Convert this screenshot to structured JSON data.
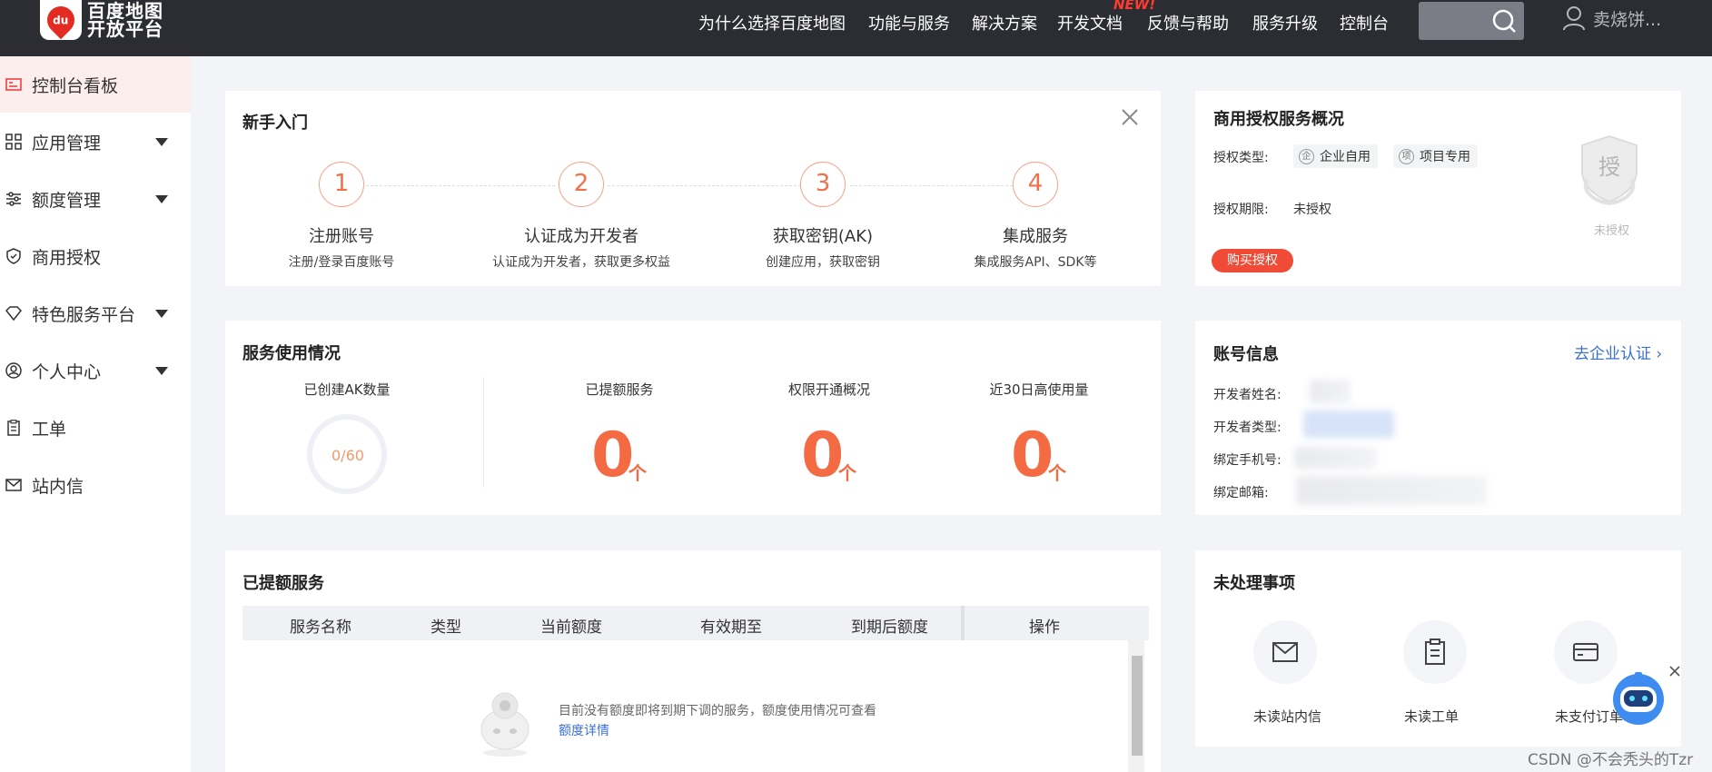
{
  "brand": {
    "logo_mark": "du",
    "name_line1": "百度地图",
    "name_line2": "开放平台"
  },
  "nav": {
    "items": [
      "为什么选择百度地图",
      "功能与服务",
      "解决方案",
      "开发文档",
      "反馈与帮助",
      "服务升级",
      "控制台"
    ],
    "new_badge": "NEW!",
    "user_name": "卖烧饼..."
  },
  "sidebar": {
    "items": [
      {
        "label": "控制台看板",
        "icon": "dashboard-icon",
        "expandable": false,
        "active": true
      },
      {
        "label": "应用管理",
        "icon": "grid-icon",
        "expandable": true
      },
      {
        "label": "额度管理",
        "icon": "sliders-icon",
        "expandable": true
      },
      {
        "label": "商用授权",
        "icon": "shield-icon",
        "expandable": false
      },
      {
        "label": "特色服务平台",
        "icon": "gem-icon",
        "expandable": true
      },
      {
        "label": "个人中心",
        "icon": "user-circle-icon",
        "expandable": true
      },
      {
        "label": "工单",
        "icon": "clipboard-icon",
        "expandable": false
      },
      {
        "label": "站内信",
        "icon": "mail-icon",
        "expandable": false
      }
    ]
  },
  "onboarding": {
    "title": "新手入门",
    "steps": [
      {
        "num": "1",
        "title": "注册账号",
        "sub": "注册/登录百度账号"
      },
      {
        "num": "2",
        "title": "认证成为开发者",
        "sub": "认证成为开发者，获取更多权益"
      },
      {
        "num": "3",
        "title": "获取密钥(AK)",
        "sub": "创建应用，获取密钥"
      },
      {
        "num": "4",
        "title": "集成服务",
        "sub": "集成服务API、SDK等"
      }
    ]
  },
  "usage": {
    "title": "服务使用情况",
    "ak_label": "已创建AK数量",
    "ak_value": "0/60",
    "ak_used": 0,
    "ak_total": 60,
    "stats": [
      {
        "label": "已提额服务",
        "value": "0",
        "unit": "个"
      },
      {
        "label": "权限开通概况",
        "value": "0",
        "unit": "个"
      },
      {
        "label": "近30日高使用量",
        "value": "0",
        "unit": "个"
      }
    ]
  },
  "quota_services": {
    "title": "已提额服务",
    "columns": [
      "服务名称",
      "类型",
      "当前额度",
      "有效期至",
      "到期后额度",
      "操作"
    ],
    "empty_text": "目前没有额度即将到期下调的服务，额度使用情况可查看",
    "empty_link": "额度详情"
  },
  "license": {
    "title": "商用授权服务概况",
    "type_label": "授权类型:",
    "type_tags": [
      {
        "mark": "企",
        "label": "企业自用"
      },
      {
        "mark": "项",
        "label": "项目专用"
      }
    ],
    "period_label": "授权期限:",
    "period_value": "未授权",
    "buy_button": "购买授权",
    "badge_char": "授",
    "badge_label": "未授权"
  },
  "account": {
    "title": "账号信息",
    "verify_link": "去企业认证",
    "fields": [
      "开发者姓名:",
      "开发者类型:",
      "绑定手机号:",
      "绑定邮箱:"
    ]
  },
  "todo": {
    "title": "未处理事项",
    "items": [
      {
        "label": "未读站内信",
        "icon": "envelope-icon"
      },
      {
        "label": "未读工单",
        "icon": "clipboard-icon"
      },
      {
        "label": "未支付订单",
        "icon": "card-icon"
      }
    ]
  },
  "watermark": "CSDN @不会秃头的Tzr",
  "colors": {
    "topbar": "#2b2d33",
    "accent": "#f46a43",
    "buy": "#ef4b37",
    "link": "#3b6fd4",
    "active_bg": "#fdeeee"
  }
}
